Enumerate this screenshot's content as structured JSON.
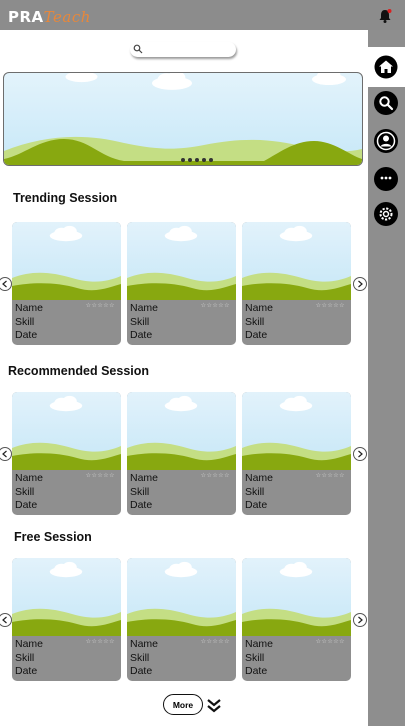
{
  "header": {
    "logo_main": "PRA",
    "logo_accent": "Teach",
    "bell_icon": "bell-icon",
    "notification_color": "#d92020"
  },
  "search": {
    "placeholder": ""
  },
  "banner": {
    "slides": 5
  },
  "sidebar": {
    "items": [
      {
        "icon": "home-icon",
        "active": true
      },
      {
        "icon": "search-icon",
        "active": false
      },
      {
        "icon": "profile-icon",
        "active": false
      },
      {
        "icon": "chat-icon",
        "active": false
      },
      {
        "icon": "gear-icon",
        "active": false
      }
    ]
  },
  "sections": [
    {
      "title": "Trending Session",
      "cards": [
        {
          "name": "Name",
          "skill": "Skill",
          "date": "Date",
          "rating": "☆☆☆☆☆"
        },
        {
          "name": "Name",
          "skill": "Skill",
          "date": "Date",
          "rating": "☆☆☆☆☆"
        },
        {
          "name": "Name",
          "skill": "Skill",
          "date": "Date",
          "rating": "☆☆☆☆☆"
        }
      ]
    },
    {
      "title": "Recommended Session",
      "cards": [
        {
          "name": "Name",
          "skill": "Skill",
          "date": "Date",
          "rating": "☆☆☆☆☆"
        },
        {
          "name": "Name",
          "skill": "Skill",
          "date": "Date",
          "rating": "☆☆☆☆☆"
        },
        {
          "name": "Name",
          "skill": "Skill",
          "date": "Date",
          "rating": "☆☆☆☆☆"
        }
      ]
    },
    {
      "title": "Free Session",
      "cards": [
        {
          "name": "Name",
          "skill": "Skill",
          "date": "Date",
          "rating": "☆☆☆☆☆"
        },
        {
          "name": "Name",
          "skill": "Skill",
          "date": "Date",
          "rating": "☆☆☆☆☆"
        },
        {
          "name": "Name",
          "skill": "Skill",
          "date": "Date",
          "rating": "☆☆☆☆☆"
        }
      ]
    }
  ],
  "more": {
    "label": "More",
    "icon": "chevron-double-down-icon"
  },
  "colors": {
    "topbar": "#8c8c8c",
    "sidebar": "#8e8e8e",
    "card_bg": "#8f8f8f",
    "hill_dark": "#88a810",
    "hill_light": "#c4de84",
    "sky": "#d4ecf8"
  }
}
